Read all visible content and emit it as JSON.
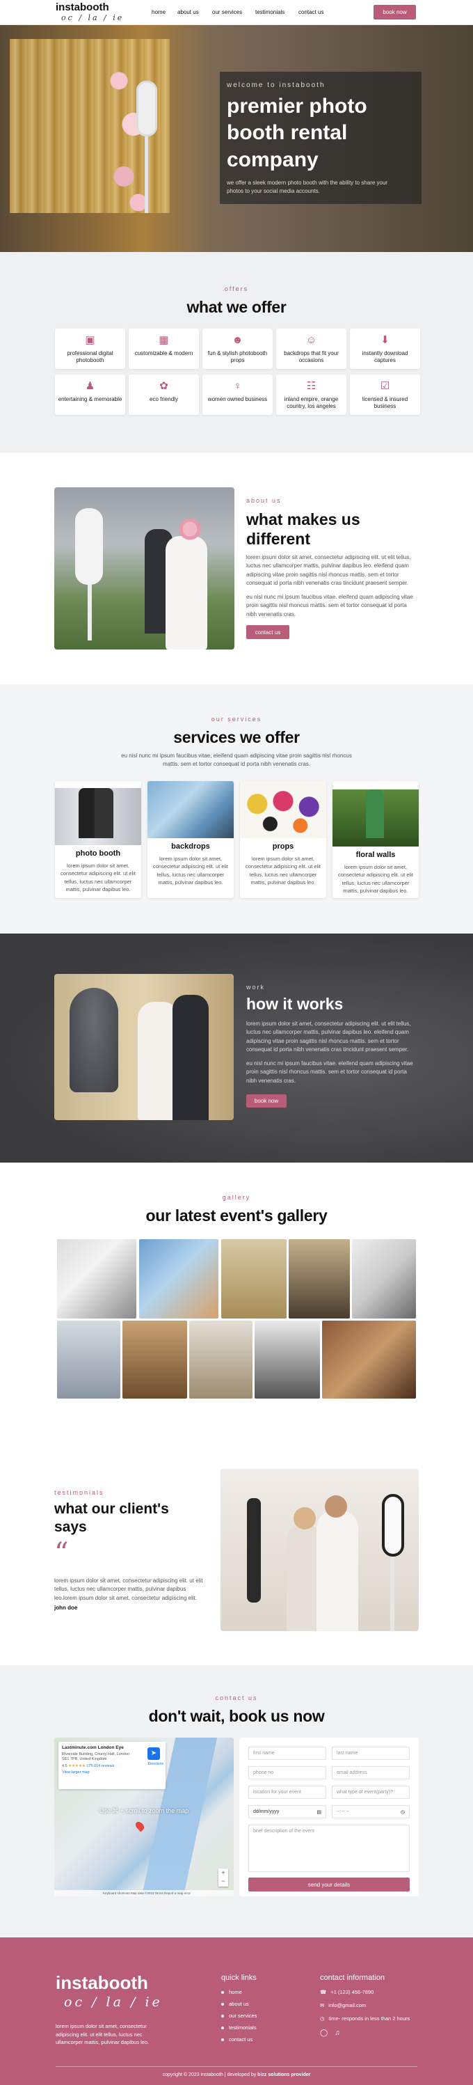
{
  "brand": {
    "name": "instabooth",
    "tagline": "oc / la / ie"
  },
  "nav": {
    "items": [
      "home",
      "about us",
      "our services",
      "testimonials",
      "contact us"
    ],
    "cta": "book now"
  },
  "hero": {
    "kicker": "welcome to instabooth",
    "title": "premier photo booth rental company",
    "desc": "we offer a sleek modern photo booth with the ability to share your photos to your social media accounts."
  },
  "offers": {
    "kicker": "offers",
    "title": "what we offer",
    "items": [
      {
        "label": "professional digital photobooth",
        "icon": "photo-booth-icon"
      },
      {
        "label": "customizable & modern",
        "icon": "image-icon"
      },
      {
        "label": "fun & stylish photobooth props",
        "icon": "mask-icon"
      },
      {
        "label": "backdrops that fit your occasions",
        "icon": "smiley-icon"
      },
      {
        "label": "instantly download captures",
        "icon": "download-icon"
      },
      {
        "label": "entertaining & memorable",
        "icon": "users-icon"
      },
      {
        "label": "eco friendly",
        "icon": "leaf-icon"
      },
      {
        "label": "women owned business",
        "icon": "woman-icon"
      },
      {
        "label": "inland empire, orange country, los angeles",
        "icon": "map-icon"
      },
      {
        "label": "licensed & insured business",
        "icon": "certificate-icon"
      }
    ]
  },
  "about": {
    "kicker": "about us",
    "title": "what makes us different",
    "p1": "lorem ipsum dolor sit amet, consectetur adipiscing elit. ut elit tellus, luctus nec ullamcorper mattis, pulvinar dapibus leo. eleifend quam adipiscing vitae proin sagittis nisl rhoncus mattis. sem et tortor consequat id porta nibh venenatis cras tincidunt praesent semper.",
    "p2": "eu nisl nunc mi ipsum faucibus vitae. eleifend quam adipiscing vitae proin sagittis nisl rhoncus mattis. sem et tortor consequat id porta nibh venenatis cras.",
    "cta": "contact us"
  },
  "services": {
    "kicker": "our services",
    "title": "services we offer",
    "desc": "eu nisl nunc mi ipsum faucibus vitae, eleifend quam adipiscing vitae proin sagittis nisl rhoncus mattis. sem et tortor consequat id porta nibh venenatis cras.",
    "items": [
      {
        "title": "photo booth",
        "desc": "lorem ipsum dolor sit amet, consectetur adipiscing elit. ut elit tellus, luctus nec ullamcorper mattis, pulvinar dapibus leo."
      },
      {
        "title": "backdrops",
        "desc": "lorem ipsum dolor sit amet, consectetur adipiscing elit. ut elit tellus, luctus nec ullamcorper mattis, pulvinar dapibus leo."
      },
      {
        "title": "props",
        "desc": "lorem ipsum dolor sit amet, consectetur adipiscing elit. ut elit tellus, luctus nec ullamcorper mattis, pulvinar dapibus leo."
      },
      {
        "title": "floral walls",
        "desc": "lorem ipsum dolor sit amet, consectetur adipiscing elit. ut elit tellus, luctus nec ullamcorper mattis, pulvinar dapibus leo."
      }
    ]
  },
  "how": {
    "kicker": "work",
    "title": "how it works",
    "p1": "lorem ipsum dolor sit amet, consectetur adipiscing elit. ut elit tellus, luctus nec ullamcorper mattis, pulvinar dapibus leo. eleifend quam adipiscing vitae proin sagittis nisl rhoncus mattis. sem et tortor consequat id porta nibh venenatis cras tincidunt praesent semper.",
    "p2": "eu nisl nunc mi ipsum faucibus vitae. eleifend quam adipiscing vitae proin sagittis nisl rhoncus mattis. sem et tortor consequat id porta nibh venenatis cras.",
    "cta": "book now"
  },
  "gallery": {
    "kicker": "gallery",
    "title": "our latest event's gallery"
  },
  "testimonials": {
    "kicker": "testimonials",
    "title": "what our client's says",
    "quote": "lorem ipsum dolor sit amet, consectetur adipiscing elit. ut elit tellus, luctus nec ullamcorper mattis, pulvinar dapibus leo.lorem ipsum dolor sit amet, consectetur adipiscing elit.",
    "author": "john doe"
  },
  "contact": {
    "kicker": "contact us",
    "title": "don't wait, book us now",
    "map": {
      "place": "Lastminute.com London Eye",
      "address": "Riverside Building, County Hall, London SE1 7PB, United Kingdom",
      "rating": "4.5",
      "reviews": "175,014 reviews",
      "link": "View larger map",
      "hint": "Use ⌘ + scroll to zoom the map",
      "directions": "Directions",
      "footer": "Keyboard shortcuts  Map data ©2023  Terms  Report a map error"
    },
    "fields": {
      "first": "first name",
      "last": "last name",
      "phone": "phone no",
      "email": "email address",
      "location": "location for your event",
      "event_type": "what type of event(party)?",
      "date": "dd/mm/yyyy",
      "time": "--:-- --",
      "brief": "brief description of the event"
    },
    "submit": "send your details"
  },
  "footer": {
    "quick_title": "quick links",
    "links": [
      "home",
      "about us",
      "our services",
      "testimonials",
      "contact us"
    ],
    "contact_title": "contact information",
    "phone": "+1 (123) 456-7890",
    "email": "info@gmail.com",
    "response": "time- responds in less than 2 hours",
    "about": "lorem ipsum dolor sit amet, consectetur adipiscing elit. ut elit tellus, luctus nec ullamcorper mattis, pulvinar dapibus leo.",
    "copyright": "copyright © 2023 instabooth | developed by",
    "developer": "bizz solutions provider"
  }
}
